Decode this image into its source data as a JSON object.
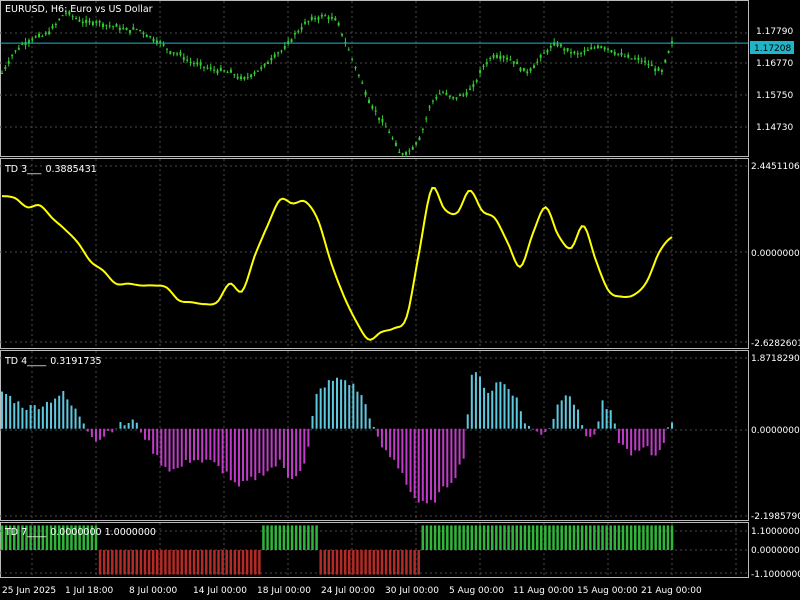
{
  "symbol_title": "EURUSD, H6:  Euro vs US Dollar",
  "colors": {
    "background": "#000000",
    "grid": "#4a4a4a",
    "candle": "#33cc33",
    "price_line": "#1fb5c8",
    "td3_line": "#ffff00",
    "td4_positive": "#5ec8df",
    "td4_negative": "#c03cc8",
    "td7_positive": "#31b43a",
    "td7_negative": "#b42a26",
    "text": "#ffffff"
  },
  "time_axis": [
    "25 Jun 2025",
    "1 Jul 18:00",
    "8 Jul 00:00",
    "14 Jul 00:00",
    "18 Jul 00:00",
    "24 Jul 00:00",
    "30 Jul 00:00",
    "5 Aug 00:00",
    "11 Aug 00:00",
    "15 Aug 00:00",
    "21 Aug 00:00"
  ],
  "panels": {
    "price": {
      "ticks": [
        "1.17790",
        "1.16770",
        "1.15750",
        "1.14730"
      ],
      "current_price": "1.17208"
    },
    "td3": {
      "label": "TD 3___",
      "value": "0.3885431",
      "ticks": [
        "2.4451106",
        "0.0000000",
        "-2.6282601"
      ]
    },
    "td4": {
      "label": "TD 4____",
      "value": "0.3191735",
      "ticks": [
        "1.8718290",
        "0.0000000",
        "-2.1985790"
      ]
    },
    "td7": {
      "label": "TD 7____",
      "value": "0.0000000 1.0000000",
      "ticks": [
        "1.1000000",
        "0.0000000",
        "-1.1000000"
      ]
    }
  },
  "chart_data": [
    {
      "type": "candlestick",
      "title": "EURUSD, H6: Euro vs US Dollar",
      "ylim": [
        1.1415,
        1.1835
      ],
      "x": [
        "25 Jun 2025",
        "1 Jul 18:00",
        "8 Jul 00:00",
        "14 Jul 00:00",
        "18 Jul 00:00",
        "24 Jul 00:00",
        "30 Jul 00:00",
        "5 Aug 00:00",
        "11 Aug 00:00",
        "15 Aug 00:00",
        "21 Aug 00:00"
      ],
      "close_path": [
        1.164,
        1.169,
        1.172,
        1.1735,
        1.174,
        1.1765,
        1.1805,
        1.179,
        1.1775,
        1.178,
        1.177,
        1.1765,
        1.1755,
        1.176,
        1.174,
        1.1725,
        1.17,
        1.169,
        1.167,
        1.166,
        1.165,
        1.1645,
        1.164,
        1.162,
        1.164,
        1.1655,
        1.169,
        1.1705,
        1.1745,
        1.1775,
        1.179,
        1.1795,
        1.178,
        1.171,
        1.164,
        1.157,
        1.152,
        1.148,
        1.142,
        1.143,
        1.147,
        1.156,
        1.159,
        1.157,
        1.158,
        1.16,
        1.166,
        1.169,
        1.1685,
        1.167,
        1.164,
        1.1665,
        1.17,
        1.172,
        1.17,
        1.169,
        1.17,
        1.1715,
        1.1705,
        1.169,
        1.168,
        1.1675,
        1.166,
        1.164,
        1.172
      ],
      "current_price": 1.17208
    },
    {
      "type": "line",
      "name": "TD 3",
      "ylim": [
        -2.6282601,
        2.4451106
      ],
      "values": [
        1.45,
        1.4,
        1.15,
        1.2,
        0.85,
        0.55,
        0.2,
        -0.3,
        -0.55,
        -0.9,
        -0.9,
        -0.95,
        -0.95,
        -1.0,
        -1.35,
        -1.4,
        -1.45,
        -1.4,
        -0.9,
        -1.1,
        -0.15,
        0.65,
        1.35,
        1.25,
        1.3,
        0.8,
        -0.3,
        -1.2,
        -1.9,
        -2.4,
        -2.2,
        -2.1,
        -1.8,
        -0.05,
        1.65,
        1.1,
        1.0,
        1.6,
        1.05,
        0.85,
        0.2,
        -0.45,
        0.45,
        1.15,
        0.4,
        0.05,
        0.65,
        -0.3,
        -1.1,
        -1.25,
        -1.2,
        -0.85,
        -0.05,
        0.35
      ]
    },
    {
      "type": "bar",
      "name": "TD 4",
      "ylim": [
        -2.198579,
        1.871829
      ],
      "values": [
        0.9,
        0.75,
        0.6,
        0.5,
        0.55,
        0.6,
        0.75,
        0.85,
        0.55,
        0.3,
        -0.05,
        -0.3,
        -0.1,
        0.05,
        0.1,
        0.2,
        -0.05,
        -0.4,
        -0.75,
        -0.95,
        -1.0,
        -0.85,
        -0.7,
        -0.8,
        -0.8,
        -0.95,
        -1.1,
        -1.45,
        -1.3,
        -1.2,
        -1.05,
        -0.95,
        -0.8,
        -1.2,
        -1.05,
        -0.8,
        0.75,
        1.05,
        1.15,
        1.2,
        1.1,
        0.9,
        0.5,
        -0.2,
        -0.55,
        -0.75,
        -1.05,
        -1.55,
        -1.8,
        -1.85,
        -1.65,
        -1.4,
        -1.15,
        -0.75,
        1.35,
        1.2,
        0.85,
        1.15,
        1.05,
        0.8,
        0.2,
        -0.05,
        -0.1,
        0.05,
        0.65,
        0.95,
        0.5,
        -0.1,
        -0.25,
        0.6,
        0.35,
        -0.35,
        -0.55,
        -0.6,
        -0.45,
        -0.7,
        -0.3,
        0.2
      ]
    },
    {
      "type": "bar",
      "name": "TD 7",
      "ylim": [
        -1.1,
        1.1
      ],
      "segments": [
        {
          "value": 1,
          "from": 0,
          "to": 0.146
        },
        {
          "value": -1,
          "from": 0.146,
          "to": 0.388
        },
        {
          "value": 1,
          "from": 0.388,
          "to": 0.472
        },
        {
          "value": -1,
          "from": 0.472,
          "to": 0.623
        },
        {
          "value": 1,
          "from": 0.623,
          "to": 1.0
        }
      ]
    }
  ]
}
